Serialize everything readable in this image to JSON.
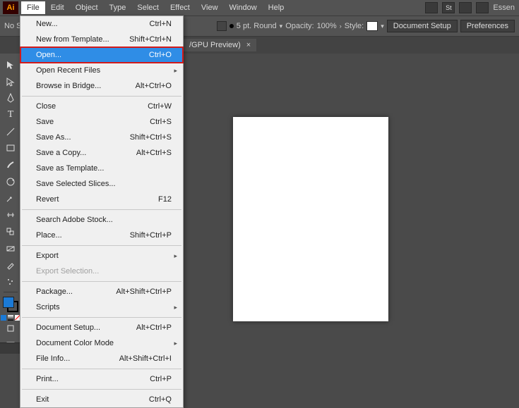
{
  "app": {
    "logo": "Ai",
    "workspace_label": "Essen"
  },
  "menubar": [
    "File",
    "Edit",
    "Object",
    "Type",
    "Select",
    "Effect",
    "View",
    "Window",
    "Help"
  ],
  "controlbar": {
    "left": "No Se",
    "stroke_label": "5 pt. Round",
    "opacity_label": "Opacity:",
    "opacity_value": "100%",
    "style_label": "Style:",
    "docsetup": "Document Setup",
    "prefs": "Preferences"
  },
  "tab": {
    "title": "/GPU Preview)",
    "close": "×"
  },
  "dropdown": {
    "groups": [
      [
        {
          "label": "New...",
          "shortcut": "Ctrl+N"
        },
        {
          "label": "New from Template...",
          "shortcut": "Shift+Ctrl+N"
        },
        {
          "label": "Open...",
          "shortcut": "Ctrl+O",
          "highlight": true
        },
        {
          "label": "Open Recent Files",
          "submenu": true
        },
        {
          "label": "Browse in Bridge...",
          "shortcut": "Alt+Ctrl+O"
        }
      ],
      [
        {
          "label": "Close",
          "shortcut": "Ctrl+W"
        },
        {
          "label": "Save",
          "shortcut": "Ctrl+S"
        },
        {
          "label": "Save As...",
          "shortcut": "Shift+Ctrl+S"
        },
        {
          "label": "Save a Copy...",
          "shortcut": "Alt+Ctrl+S"
        },
        {
          "label": "Save as Template..."
        },
        {
          "label": "Save Selected Slices..."
        },
        {
          "label": "Revert",
          "shortcut": "F12"
        }
      ],
      [
        {
          "label": "Search Adobe Stock..."
        },
        {
          "label": "Place...",
          "shortcut": "Shift+Ctrl+P"
        }
      ],
      [
        {
          "label": "Export",
          "submenu": true
        },
        {
          "label": "Export Selection...",
          "disabled": true
        }
      ],
      [
        {
          "label": "Package...",
          "shortcut": "Alt+Shift+Ctrl+P"
        },
        {
          "label": "Scripts",
          "submenu": true
        }
      ],
      [
        {
          "label": "Document Setup...",
          "shortcut": "Alt+Ctrl+P"
        },
        {
          "label": "Document Color Mode",
          "submenu": true
        },
        {
          "label": "File Info...",
          "shortcut": "Alt+Shift+Ctrl+I"
        }
      ],
      [
        {
          "label": "Print...",
          "shortcut": "Ctrl+P"
        }
      ],
      [
        {
          "label": "Exit",
          "shortcut": "Ctrl+Q"
        }
      ]
    ]
  }
}
